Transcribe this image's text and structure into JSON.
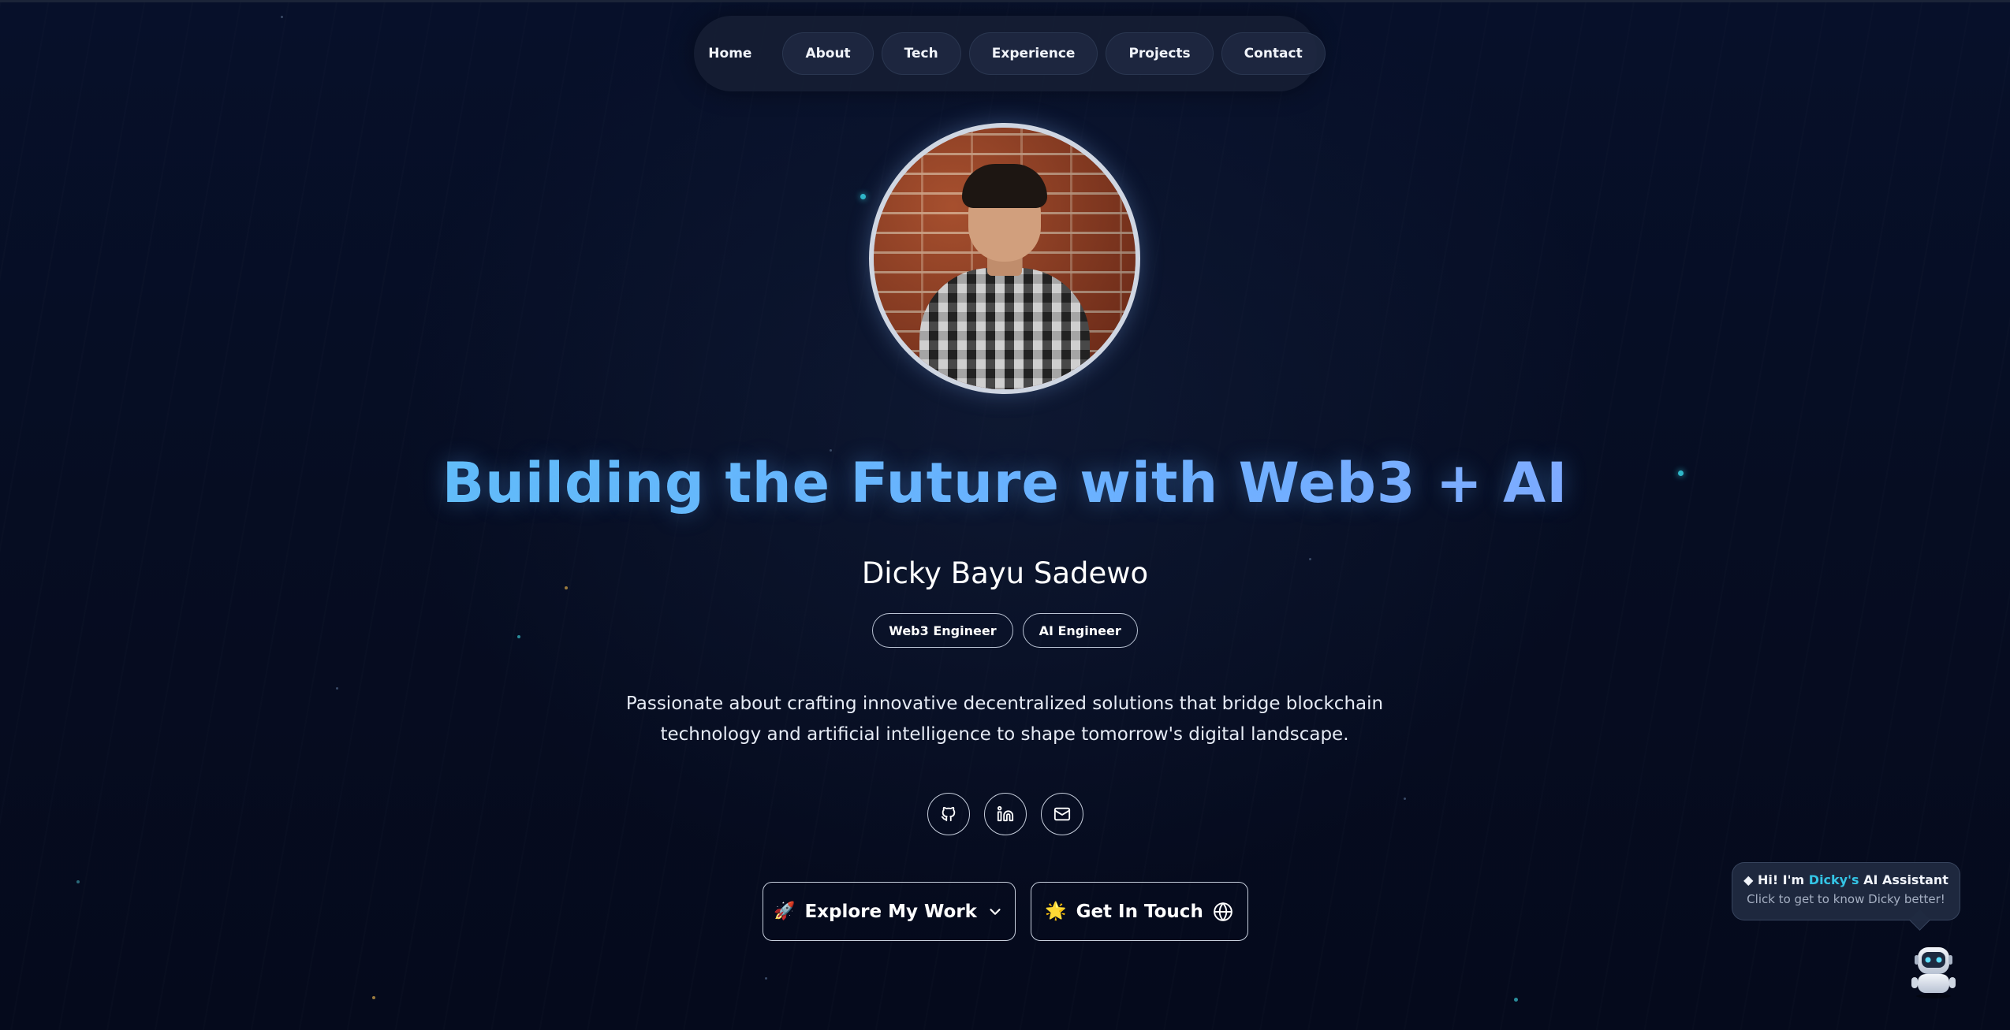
{
  "nav": {
    "items": [
      {
        "label": "Home"
      },
      {
        "label": "About"
      },
      {
        "label": "Tech"
      },
      {
        "label": "Experience"
      },
      {
        "label": "Projects"
      },
      {
        "label": "Contact"
      }
    ]
  },
  "hero": {
    "headline": "Building the Future with Web3 + AI",
    "name": "Dicky Bayu Sadewo",
    "roles": [
      "Web3 Engineer",
      "AI Engineer"
    ],
    "description": "Passionate about crafting innovative decentralized solutions that bridge blockchain technology and artificial intelligence to shape tomorrow's digital landscape."
  },
  "socials": {
    "icons": [
      "github-icon",
      "linkedin-icon",
      "mail-icon"
    ]
  },
  "cta": {
    "explore_emoji": "🚀",
    "explore_label": "Explore My Work",
    "touch_emoji": "🌟",
    "touch_label": "Get In Touch"
  },
  "assistant": {
    "prefix": "◆ Hi! I'm",
    "highlight": "Dicky's",
    "suffix": "AI Assistant",
    "subtitle": "Click to get to know Dicky better!"
  },
  "colors": {
    "background": "#050b1c",
    "headline_start": "#5cc8f5",
    "headline_end": "#9aa6ff",
    "assistant_highlight": "#34c5e6"
  }
}
